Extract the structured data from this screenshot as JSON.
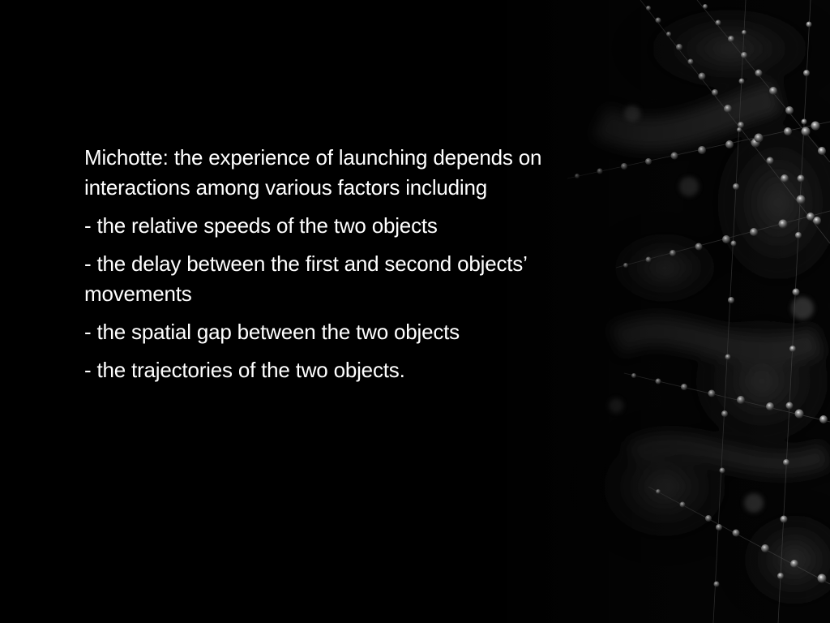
{
  "slide": {
    "background_color": "#000000",
    "text_color": "#ffffff",
    "background_image": "dew-drops-on-spider-web",
    "paragraphs": [
      "Michotte: the experience of launching depends on interactions among various factors including",
      "- the relative speeds of the two objects",
      "- the delay between the first and second objects’ movements",
      "- the spatial gap between the two objects",
      "- the trajectories of the two objects."
    ]
  }
}
